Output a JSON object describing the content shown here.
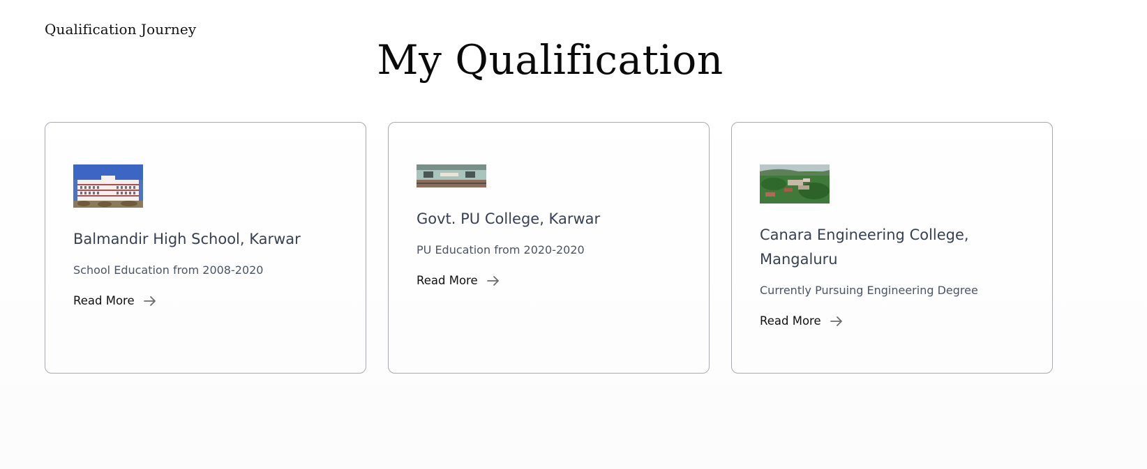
{
  "header": {
    "kicker": "Qualification Journey",
    "title": "My Qualification"
  },
  "cards": [
    {
      "title": "Balmandir High School, Karwar",
      "description": "School Education from 2008-2020",
      "link": "Read More"
    },
    {
      "title": "Govt. PU College, Karwar",
      "description": "PU Education from 2020-2020",
      "link": "Read More"
    },
    {
      "title": "Canara Engineering College, Mangaluru",
      "description": "Currently Pursuing Engineering Degree",
      "link": "Read More"
    }
  ],
  "icons": {
    "link_icon": "arrow-right-icon"
  },
  "colors": {
    "text_dark": "#111111",
    "text_muted": "#4b5563",
    "card_border": "#a9a9b0"
  }
}
